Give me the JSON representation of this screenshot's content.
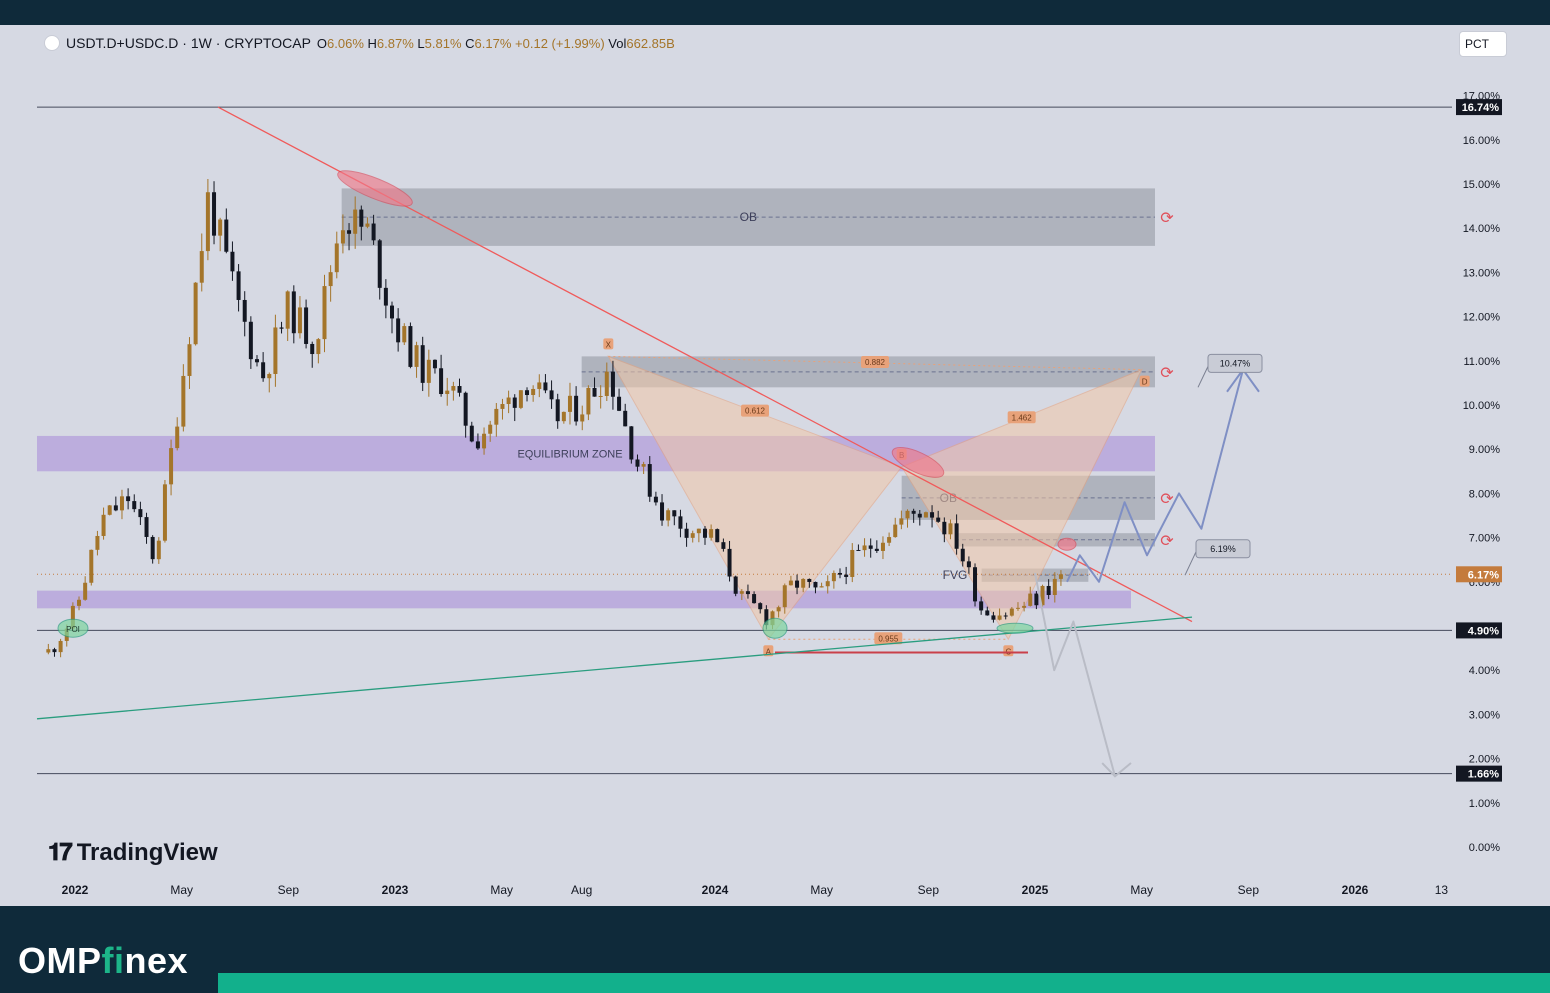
{
  "header": {
    "symbol": "USDT.D+USDC.D · 1W · CRYPTOCAP",
    "o_label": "O",
    "o_value": "6.06%",
    "h_label": "H",
    "h_value": "6.87%",
    "l_label": "L",
    "l_value": "5.81%",
    "c_label": "C",
    "c_value": "6.17%",
    "change": "+0.12 (+1.99%)",
    "vol_label": "Vol",
    "vol_value": "662.85B"
  },
  "scale_mode_button": "PCT",
  "watermark": "TradingView",
  "brand": {
    "prefix": "OMP",
    "accent": "fi",
    "suffix": "nex"
  },
  "colors": {
    "background": "#d6d9e3",
    "up_candle": "#a4752a",
    "down_candle": "#131722",
    "trendline_red": "#f05a5a",
    "trendline_green": "#2a9d7f",
    "equilibrium_zone": "#b39ddb",
    "order_block": "#9ea3ad",
    "harmonic_fill": "#f2c7a8",
    "projection_up": "#7f8fc4",
    "projection_down": "#b9bcc6"
  },
  "chart_data": {
    "type": "candlestick",
    "timeframe": "1W",
    "x_ticks": [
      "2022",
      "May",
      "Sep",
      "2023",
      "May",
      "Aug",
      "2024",
      "May",
      "Sep",
      "2025",
      "May",
      "Sep",
      "2026",
      "13"
    ],
    "y_axis": {
      "unit": "%",
      "ylim": [
        0,
        17
      ],
      "ticks": [
        "0.00%",
        "1.00%",
        "2.00%",
        "3.00%",
        "4.00%",
        "5.00%",
        "6.00%",
        "7.00%",
        "8.00%",
        "9.00%",
        "10.00%",
        "11.00%",
        "12.00%",
        "13.00%",
        "14.00%",
        "15.00%",
        "16.00%",
        "17.00%"
      ]
    },
    "price_labels": [
      {
        "value": 16.74,
        "text": "16.74%"
      },
      {
        "value": 6.17,
        "text": "6.17%"
      },
      {
        "value": 4.9,
        "text": "4.90%"
      },
      {
        "value": 1.66,
        "text": "1.66%"
      }
    ],
    "series": [
      {
        "name": "USDT.D+USDC.D",
        "close_path": [
          [
            "2021-12",
            4.4
          ],
          [
            "2022-01",
            5.3
          ],
          [
            "2022-02",
            7.4
          ],
          [
            "2022-03",
            7.9
          ],
          [
            "2022-04",
            6.5
          ],
          [
            "2022-05",
            10.5
          ],
          [
            "2022-06",
            14.7
          ],
          [
            "2022-07",
            12.5
          ],
          [
            "2022-08",
            10.6
          ],
          [
            "2022-09",
            12.2
          ],
          [
            "2022-10",
            11.4
          ],
          [
            "2022-11",
            14.3
          ],
          [
            "2022-12",
            13.9
          ],
          [
            "2023-01",
            11.8
          ],
          [
            "2023-02",
            10.8
          ],
          [
            "2023-03",
            10.5
          ],
          [
            "2023-04",
            9.2
          ],
          [
            "2023-05",
            9.9
          ],
          [
            "2023-06",
            10.6
          ],
          [
            "2023-07",
            9.7
          ],
          [
            "2023-08",
            10.0
          ],
          [
            "2023-09",
            10.8
          ],
          [
            "2023-10",
            8.8
          ],
          [
            "2023-11",
            7.6
          ],
          [
            "2023-12",
            7.2
          ],
          [
            "2024-01",
            7.0
          ],
          [
            "2024-02",
            5.6
          ],
          [
            "2024-03",
            5.2
          ],
          [
            "2024-04",
            6.0
          ],
          [
            "2024-05",
            5.7
          ],
          [
            "2024-06",
            6.4
          ],
          [
            "2024-07",
            6.9
          ],
          [
            "2024-08",
            7.4
          ],
          [
            "2024-09",
            7.7
          ],
          [
            "2024-10",
            7.0
          ],
          [
            "2024-11",
            5.4
          ],
          [
            "2024-12",
            5.3
          ],
          [
            "2025-01",
            5.6
          ],
          [
            "2025-02",
            6.17
          ]
        ]
      }
    ],
    "annotations": {
      "order_blocks": [
        {
          "label": "OB",
          "from": "2022-11",
          "to": "2025-06",
          "low": 13.6,
          "high": 14.9
        },
        {
          "label": "",
          "from": "2023-08",
          "to": "2025-06",
          "low": 10.4,
          "high": 11.1
        },
        {
          "label": "OB",
          "from": "2024-08",
          "to": "2025-06",
          "low": 7.4,
          "high": 8.4
        },
        {
          "label": "",
          "from": "2024-10",
          "to": "2025-06",
          "low": 6.8,
          "high": 7.1
        },
        {
          "label": "FVG",
          "from": "2024-11",
          "to": "2025-03",
          "low": 6.0,
          "high": 6.3
        }
      ],
      "zones": [
        {
          "label": "EQUILIBRIUM ZONE",
          "low": 8.5,
          "high": 9.3
        },
        {
          "label": "",
          "low": 5.4,
          "high": 5.8
        }
      ],
      "horizontal_lines": [
        16.74,
        4.9,
        1.66
      ],
      "harmonic_pattern": {
        "points": [
          {
            "label": "X",
            "date": "2023-09",
            "value": 11.1
          },
          {
            "label": "A",
            "date": "2024-03",
            "value": 4.7
          },
          {
            "label": "B",
            "date": "2024-08",
            "value": 8.6
          },
          {
            "label": "C",
            "date": "2024-12",
            "value": 4.7
          },
          {
            "label": "D",
            "date": "2025-05",
            "value": 10.8
          }
        ],
        "ratios": [
          "0.612",
          "1.462",
          "0.955",
          "0.882"
        ]
      },
      "markers": [
        "POI"
      ],
      "targets": [
        "10.47%",
        "6.19%"
      ]
    }
  }
}
